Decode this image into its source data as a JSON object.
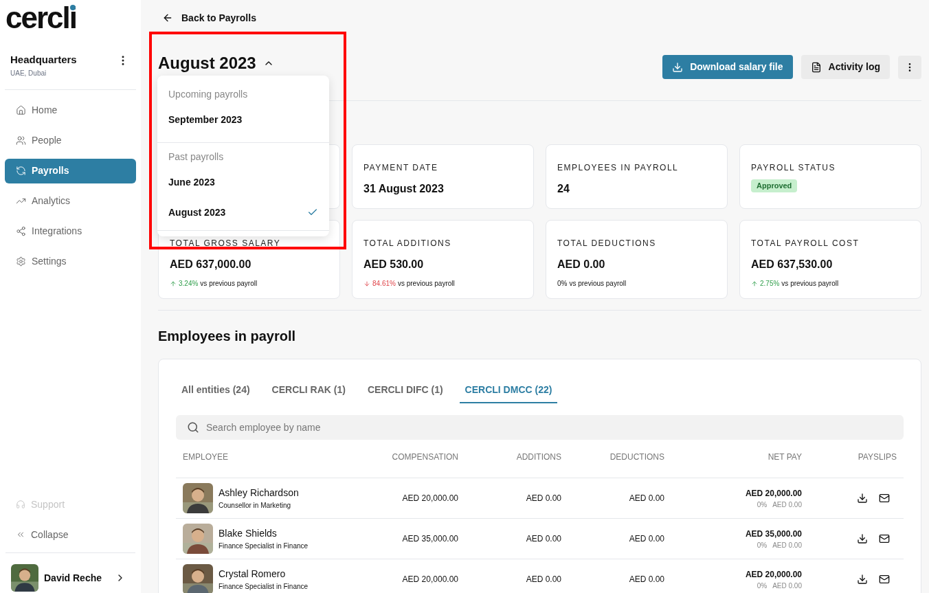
{
  "logo": {
    "text": "cercli"
  },
  "workspace": {
    "name": "Headquarters",
    "location": "UAE, Dubai"
  },
  "nav": [
    {
      "label": "Home",
      "selected": false
    },
    {
      "label": "People",
      "selected": false
    },
    {
      "label": "Payrolls",
      "selected": true
    },
    {
      "label": "Analytics",
      "selected": false
    },
    {
      "label": "Integrations",
      "selected": false
    },
    {
      "label": "Settings",
      "selected": false
    }
  ],
  "footer_nav": [
    {
      "label": "Support",
      "disabled": true
    },
    {
      "label": "Collapse",
      "disabled": false
    }
  ],
  "user": {
    "name": "David Reche"
  },
  "back_link": "Back to Payrolls",
  "period_selector": {
    "label": "August 2023",
    "expanded": true
  },
  "actions": [
    {
      "label": "Download salary file",
      "kind": "primary"
    },
    {
      "label": "Activity log",
      "kind": "secondary"
    },
    {
      "kind": "more"
    }
  ],
  "period_menu": [
    {
      "heading": "Upcoming payrolls",
      "items": [
        {
          "label": "September 2023",
          "selected": false
        }
      ]
    },
    {
      "heading": "Past payrolls",
      "items": [
        {
          "label": "June 2023",
          "selected": false
        },
        {
          "label": "August 2023",
          "selected": true
        }
      ]
    }
  ],
  "stats": [
    {
      "label": "PAYMENT DATE",
      "kind": "text",
      "value": "31 August 2023"
    },
    {
      "label": "EMPLOYEES IN PAYROLL",
      "kind": "text",
      "value": "24"
    },
    {
      "label": "PAYROLL STATUS",
      "kind": "badge",
      "value": "Approved"
    },
    {
      "label": "TOTAL GROSS SALARY",
      "kind": "amount",
      "value": "AED 637,000.00",
      "change": {
        "kind": "up",
        "text": "3.24%"
      },
      "note": "vs previous payroll"
    },
    {
      "label": "TOTAL ADDITIONS",
      "kind": "amount",
      "value": "AED 530.00",
      "change": {
        "kind": "down",
        "text": "84.61%"
      },
      "note": "vs previous payroll"
    },
    {
      "label": "TOTAL DEDUCTIONS",
      "kind": "amount",
      "value": "AED 0.00",
      "change": {
        "kind": "flat",
        "text": "0%"
      },
      "note": "vs previous payroll"
    },
    {
      "label": "TOTAL PAYROLL COST",
      "kind": "amount",
      "value": "AED 637,530.00",
      "change": {
        "kind": "up",
        "text": "2.75%"
      },
      "note": "vs previous payroll"
    }
  ],
  "employees_section": {
    "title": "Employees in payroll",
    "tabs": [
      {
        "label": "All entities (24)",
        "selected": false
      },
      {
        "label": "CERCLI RAK (1)",
        "selected": false
      },
      {
        "label": "CERCLI DIFC (1)",
        "selected": false
      },
      {
        "label": "CERCLI DMCC (22)",
        "selected": true
      }
    ],
    "search": {
      "placeholder": "Search employee by name"
    },
    "columns": [
      "EMPLOYEE",
      "COMPENSATION",
      "ADDITIONS",
      "DEDUCTIONS",
      "NET PAY",
      "PAYSLIPS"
    ],
    "rows": [
      {
        "name": "Ashley Richardson",
        "role": "Counsellor in Marketing",
        "compensation": "AED 20,000.00",
        "additions": "AED 0.00",
        "deductions": "AED 0.00",
        "net_pay": "AED 20,000.00",
        "net_change": "0%",
        "net_change_amount": "AED 0.00"
      },
      {
        "name": "Blake Shields",
        "role": "Finance Specialist in Finance",
        "compensation": "AED 35,000.00",
        "additions": "AED 0.00",
        "deductions": "AED 0.00",
        "net_pay": "AED 35,000.00",
        "net_change": "0%",
        "net_change_amount": "AED 0.00"
      },
      {
        "name": "Crystal Romero",
        "role": "Finance Specialist in Finance",
        "compensation": "AED 20,000.00",
        "additions": "AED 0.00",
        "deductions": "AED 0.00",
        "net_pay": "AED 20,000.00",
        "net_change": "0%",
        "net_change_amount": "AED 0.00"
      }
    ]
  }
}
